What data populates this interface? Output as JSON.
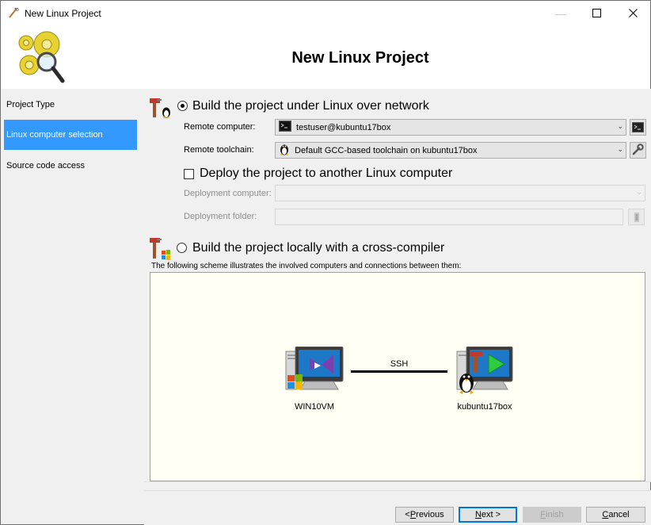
{
  "window": {
    "title": "New Linux Project"
  },
  "header": {
    "title": "New Linux Project"
  },
  "sidebar": {
    "items": [
      {
        "label": "Project Type",
        "active": false
      },
      {
        "label": "Linux computer selection",
        "active": true
      },
      {
        "label": "Source code access",
        "active": false
      }
    ]
  },
  "network_build": {
    "label": "Build the project under Linux over network",
    "selected": true,
    "remote_computer_label": "Remote computer:",
    "remote_computer_value": "testuser@kubuntu17box",
    "remote_toolchain_label": "Remote toolchain:",
    "remote_toolchain_value": "Default GCC-based toolchain on kubuntu17box",
    "deploy_label": "Deploy the project to another Linux computer",
    "deploy_checked": false,
    "deployment_computer_label": "Deployment computer:",
    "deployment_computer_value": "",
    "deployment_folder_label": "Deployment folder:",
    "deployment_folder_value": ""
  },
  "local_build": {
    "label": "Build the project locally with a cross-compiler",
    "selected": false
  },
  "scheme": {
    "caption": "The following scheme illustrates the involved computers and connections between them:",
    "left_host": "WIN10VM",
    "right_host": "kubuntu17box",
    "connection": "SSH"
  },
  "footer": {
    "previous_prefix": "< ",
    "previous_key": "P",
    "previous_rest": "revious",
    "next_key": "N",
    "next_rest": "ext >",
    "finish_key": "F",
    "finish_rest": "inish",
    "cancel_key": "C",
    "cancel_rest": "ancel"
  },
  "colors": {
    "selection": "#3399ff",
    "scheme_background": "#fffff4",
    "default_button_border": "#0078d7"
  },
  "icons": [
    "wizard-app-icon",
    "gears-magnifier-logo",
    "hammer-tux-icon",
    "terminal-icon",
    "tux-icon",
    "wrench-icon",
    "hammer-windows-icon",
    "windows-vs-computer-icon",
    "linux-computer-icon"
  ]
}
